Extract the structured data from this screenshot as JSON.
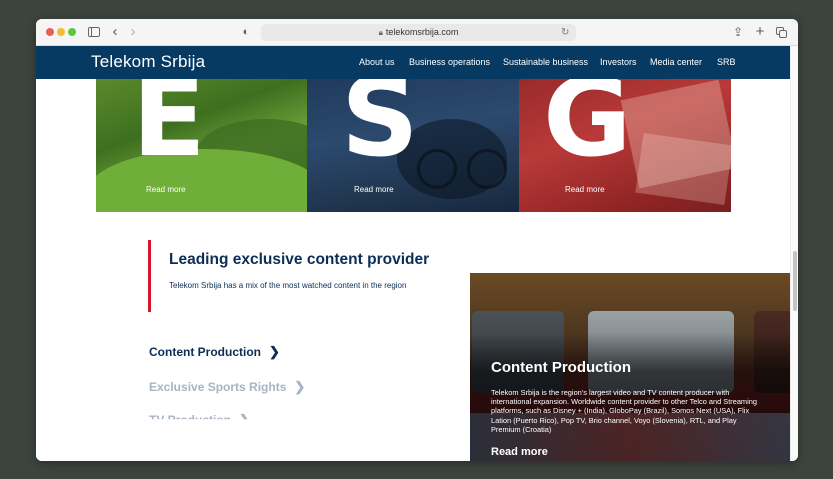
{
  "browser": {
    "url": "telekomsrbija.com"
  },
  "site": {
    "logo": "Telekom Srbija",
    "nav": [
      {
        "label": "About us"
      },
      {
        "label": "Business operations"
      },
      {
        "label": "Sustainable business"
      },
      {
        "label": "Investors"
      },
      {
        "label": "Media center"
      },
      {
        "label": "SRB"
      }
    ],
    "nav_color": "#073a62",
    "accent_color": "#d4172a"
  },
  "esg": {
    "tiles": [
      {
        "letter": "E",
        "link": "Read more"
      },
      {
        "letter": "S",
        "link": "Read more"
      },
      {
        "letter": "G",
        "link": "Read more"
      }
    ]
  },
  "content": {
    "title": "Leading exclusive content provider",
    "subtitle": "Telekom Srbija has a mix of the most watched content in the region",
    "categories": [
      {
        "label": "Content Production",
        "active": true
      },
      {
        "label": "Exclusive Sports Rights",
        "active": false
      },
      {
        "label": "TV Production",
        "active": false
      }
    ],
    "card": {
      "title": "Content Production",
      "description": "Telekom Srbija is the region's largest video and TV content producer with international expansion. Worldwide content provider to other Telco and Streaming platforms, such as Disney + (India), GloboPay (Brazil), Somos Next (USA), Flix Lation (Puerto Rico), Pop TV, Brio channel, Voyo (Slovenia), RTL, and Play Premium (Croatia)",
      "link": "Read more"
    }
  }
}
